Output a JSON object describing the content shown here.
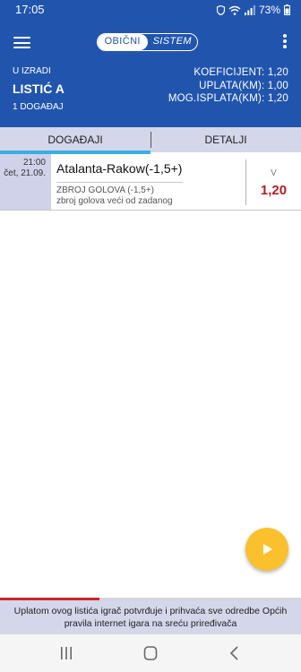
{
  "status_bar": {
    "time": "17:05",
    "battery": "73%",
    "icons": [
      "shield-icon",
      "wifi-icon",
      "signal-icon",
      "battery-icon"
    ]
  },
  "header": {
    "menu_icon": "hamburger-menu-icon",
    "mode_toggle": {
      "options": [
        "OBIČNI",
        "SISTEM"
      ],
      "selected": "OBIČNI"
    },
    "more_icon": "more-vertical-icon",
    "slip_status": "U IZRADI",
    "slip_title": "LISTIĆ A",
    "event_count": "1 DOGAĐAJ",
    "summary": [
      "KOEFICIJENT: 1,20",
      "UPLATA(KM): 1,00",
      "MOG.ISPLATA(KM): 1,20"
    ]
  },
  "tabs": [
    {
      "label": "DOGAĐAJI",
      "active": true
    },
    {
      "label": "DETALJI",
      "active": false
    }
  ],
  "events": [
    {
      "time": "21:00",
      "date": "čet, 21.09.",
      "name": "Atalanta-Rakow(-1,5+)",
      "market": "ZBROJ GOLOVA (-1,5+)",
      "description": "zbroj golova veći od zadanog",
      "tip": "V",
      "odd": "1,20"
    }
  ],
  "fab": {
    "icon": "play-icon"
  },
  "progress": {
    "fraction": 0.33
  },
  "disclaimer": "Uplatom ovog listića igrač potvrđuje i prihvaća sve odredbe Općih pravila internet igara na sreću priređivača",
  "nav_bar": {
    "icons": [
      "recent-apps-icon",
      "home-icon",
      "back-icon"
    ]
  },
  "colors": {
    "primary": "#2155ad",
    "tab_background": "#d4d6ea",
    "tab_indicator": "#3aaee4",
    "odd": "#b41e23",
    "fab": "#fbc02d",
    "progress": "#c62828"
  }
}
